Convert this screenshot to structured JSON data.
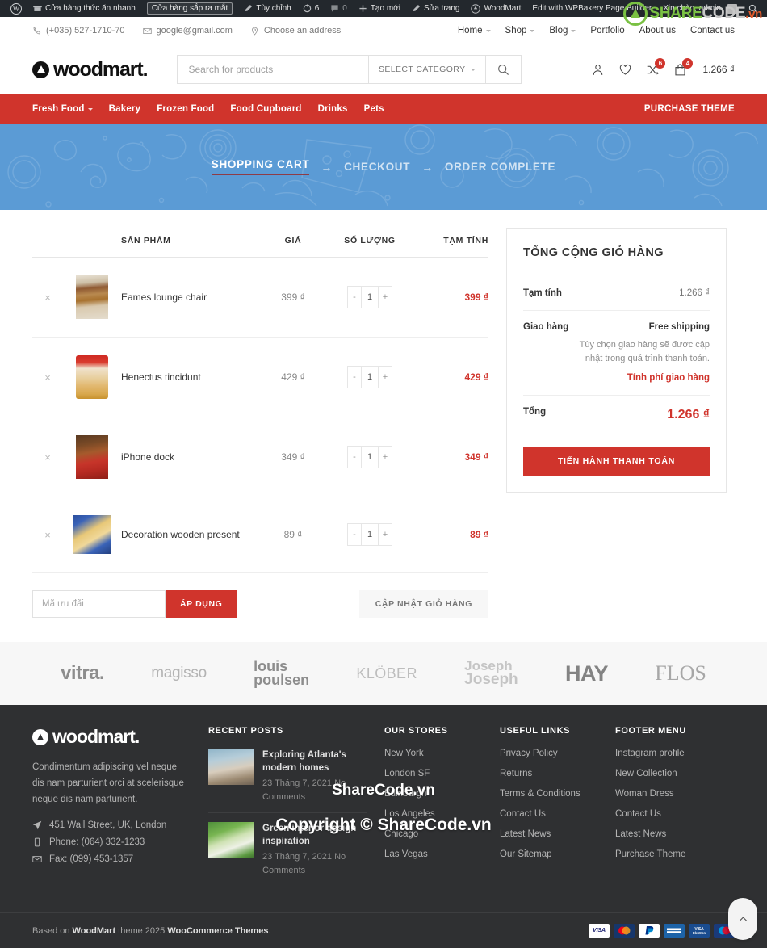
{
  "admin_bar": {
    "items": [
      {
        "icon": "wordpress-logo-icon",
        "label": ""
      },
      {
        "icon": "store-icon",
        "label": "Cửa hàng thức ăn nhanh"
      },
      {
        "icon": "",
        "label": "Cửa hàng sắp ra mắt",
        "pill": true
      },
      {
        "icon": "pencil-icon",
        "label": "Tùy chỉnh"
      },
      {
        "icon": "updates-icon",
        "label": "6"
      },
      {
        "icon": "comment-icon",
        "label": "0"
      },
      {
        "icon": "plus-icon",
        "label": "Tạo mới"
      },
      {
        "icon": "edit-icon",
        "label": "Sửa trang"
      },
      {
        "icon": "woodmart-icon",
        "label": "WoodMart"
      },
      {
        "icon": "",
        "label": "Edit with WPBakery Page Builder"
      }
    ],
    "greeting": "Xin chào, admin"
  },
  "topbar": {
    "phone": "(+035) 527-1710-70",
    "email": "google@gmail.com",
    "address": "Choose an address",
    "nav": [
      {
        "label": "Home",
        "caret": true
      },
      {
        "label": "Shop",
        "caret": true
      },
      {
        "label": "Blog",
        "caret": true
      },
      {
        "label": "Portfolio",
        "caret": false
      },
      {
        "label": "About us",
        "caret": false
      },
      {
        "label": "Contact us",
        "caret": false
      }
    ]
  },
  "header": {
    "logo_text": "woodmart.",
    "search_placeholder": "Search for products",
    "search_value": "",
    "select_category": "SELECT CATEGORY",
    "compare_count": "6",
    "cart_count": "4",
    "cart_amount": "1.266 ₫"
  },
  "main_nav": {
    "items": [
      {
        "label": "Fresh Food",
        "caret": true
      },
      {
        "label": "Bakery",
        "caret": false
      },
      {
        "label": "Frozen Food",
        "caret": false
      },
      {
        "label": "Food Cupboard",
        "caret": false
      },
      {
        "label": "Drinks",
        "caret": false
      },
      {
        "label": "Pets",
        "caret": false
      }
    ],
    "purchase_theme": "PURCHASE THEME"
  },
  "hero": {
    "steps": [
      {
        "label": "SHOPPING CART",
        "active": true
      },
      {
        "label": "CHECKOUT",
        "active": false
      },
      {
        "label": "ORDER COMPLETE",
        "active": false
      }
    ],
    "arrow": "→"
  },
  "cart": {
    "columns": {
      "remove": "",
      "thumb": "",
      "product": "SẢN PHẨM",
      "price": "GIÁ",
      "quantity": "SỐ LƯỢNG",
      "subtotal": "TẠM TÍNH"
    },
    "rows": [
      {
        "remove": "×",
        "name": "Eames lounge chair",
        "price": "399 ₫",
        "qty": "1",
        "subtotal": "399 ₫",
        "minus": "-",
        "plus": "+"
      },
      {
        "remove": "×",
        "name": "Henectus tincidunt",
        "price": "429 ₫",
        "qty": "1",
        "subtotal": "429 ₫",
        "minus": "-",
        "plus": "+"
      },
      {
        "remove": "×",
        "name": "iPhone dock",
        "price": "349 ₫",
        "qty": "1",
        "subtotal": "349 ₫",
        "minus": "-",
        "plus": "+"
      },
      {
        "remove": "×",
        "name": "Decoration wooden present",
        "price": "89 ₫",
        "qty": "1",
        "subtotal": "89 ₫",
        "minus": "-",
        "plus": "+"
      }
    ],
    "coupon_placeholder": "Mã ưu đãi",
    "coupon_value": "",
    "apply_label": "ÁP DỤNG",
    "update_label": "CẬP NHẬT GIỎ HÀNG"
  },
  "totals": {
    "title": "TỔNG CỘNG GIỎ HÀNG",
    "subtotal_label": "Tạm tính",
    "subtotal_value": "1.266 ₫",
    "shipping_label": "Giao hàng",
    "shipping_method": "Free shipping",
    "shipping_note": "Tùy chọn giao hàng sẽ được cập nhật trong quá trình thanh toán.",
    "shipping_calc": "Tính phí giao hàng",
    "total_label": "Tổng",
    "total_value": "1.266 ₫",
    "checkout_label": "TIẾN HÀNH THANH TOÁN"
  },
  "brands": [
    {
      "name": "vitra.",
      "key": "vitra"
    },
    {
      "name": "magisso",
      "key": "magisso"
    },
    {
      "name": "louis poulsen",
      "key": "louis"
    },
    {
      "name": "KLÖBER",
      "key": "klober"
    },
    {
      "name": "Joseph Joseph",
      "key": "joseph"
    },
    {
      "name": "HAY",
      "key": "hay"
    },
    {
      "name": "FLOS",
      "key": "flos"
    }
  ],
  "footer": {
    "logo_text": "woodmart.",
    "about": "Condimentum adipiscing vel neque dis nam parturient orci at scelerisque neque dis nam parturient.",
    "address": "451 Wall Street, UK, London",
    "phone": "Phone: (064) 332-1233",
    "fax": "Fax: (099) 453-1357",
    "recent_posts_title": "RECENT POSTS",
    "posts": [
      {
        "title": "Exploring Atlanta's modern homes",
        "meta": "23 Tháng 7, 2021  No Comments"
      },
      {
        "title": "Green interior design inspiration",
        "meta": "23 Tháng 7, 2021  No Comments"
      }
    ],
    "our_stores_title": "OUR STORES",
    "our_stores": [
      "New York",
      "London SF",
      "Edinburgh",
      "Los Angeles",
      "Chicago",
      "Las Vegas"
    ],
    "useful_links_title": "USEFUL LINKS",
    "useful_links": [
      "Privacy Policy",
      "Returns",
      "Terms & Conditions",
      "Contact Us",
      "Latest News",
      "Our Sitemap"
    ],
    "footer_menu_title": "FOOTER MENU",
    "footer_menu": [
      "Instagram profile",
      "New Collection",
      "Woman Dress",
      "Contact Us",
      "Latest News",
      "Purchase Theme"
    ]
  },
  "bottom": {
    "copyright_pre": "Based on ",
    "copyright_b1": "WoodMart",
    "copyright_mid": " theme 2025 ",
    "copyright_b2": "WooCommerce Themes",
    "copyright_end": ".",
    "cards": [
      "VISA",
      "MC",
      "PayPal",
      "AMEX",
      "VISA Electron",
      "Maestro"
    ]
  },
  "watermarks": {
    "brand_s1": "SHARE",
    "brand_s2": "CODE",
    "brand_s3": ".vn",
    "middle": "ShareCode.vn",
    "copyright": "Copyright © ShareCode.vn"
  },
  "colors": {
    "accent_red": "#d0342c",
    "hero_blue": "#5b9bd5",
    "footer_dark": "#2f3032",
    "adminbar": "#23282d"
  }
}
